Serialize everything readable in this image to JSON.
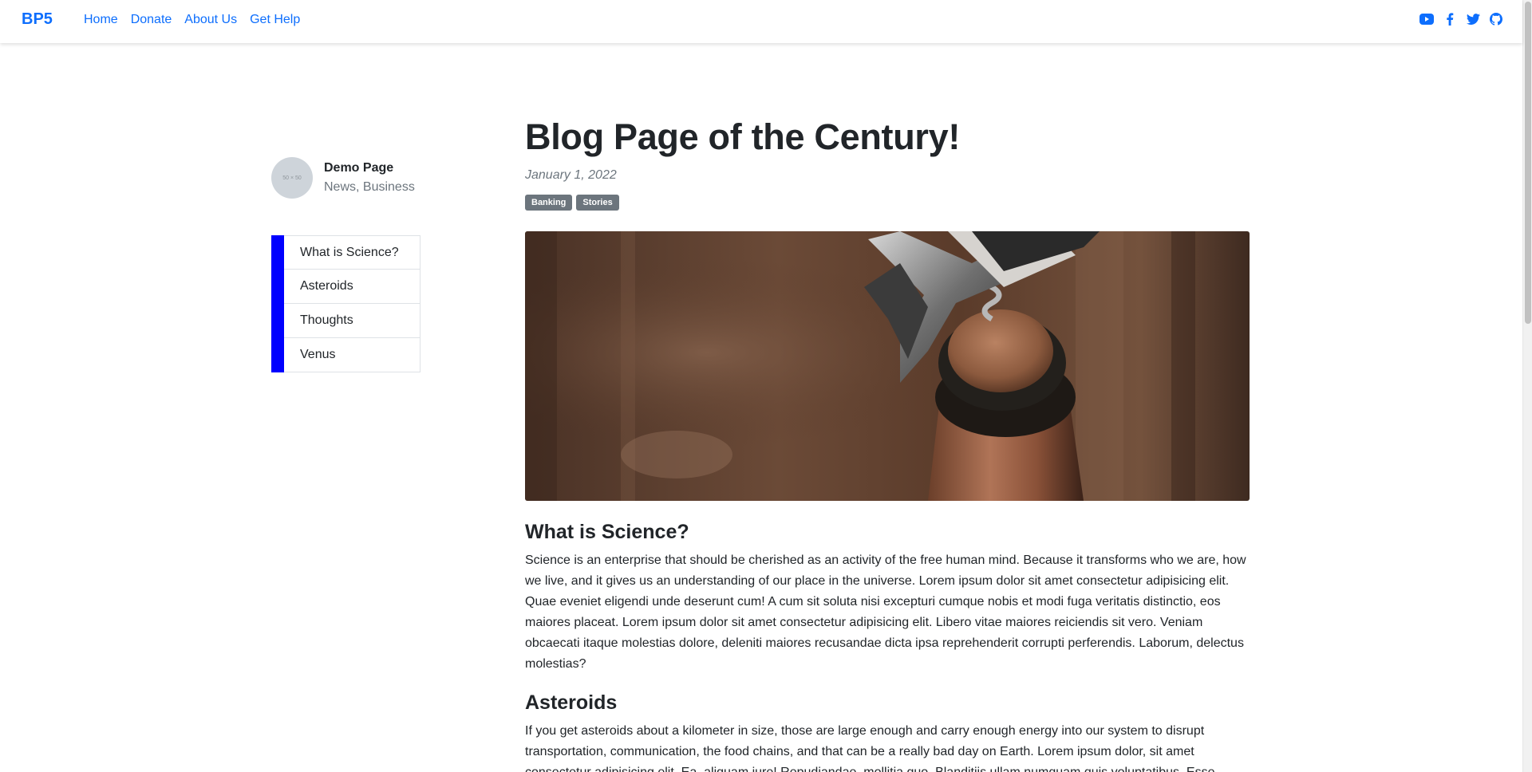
{
  "navbar": {
    "brand": "BP5",
    "links": [
      "Home",
      "Donate",
      "About Us",
      "Get Help"
    ],
    "social_icons": [
      "youtube-icon",
      "facebook-icon",
      "twitter-icon",
      "github-icon"
    ],
    "accent_color": "#0d6efd"
  },
  "sidebar": {
    "avatar_text": "50 × 50",
    "author_name": "Demo Page",
    "author_categories": "News, Business",
    "toc_accent": "#0000ff",
    "toc": [
      "What is Science?",
      "Asteroids",
      "Thoughts",
      "Venus"
    ]
  },
  "post": {
    "title": "Blog Page of the Century!",
    "date": "January 1, 2022",
    "tags": [
      "Banking",
      "Stories"
    ],
    "hero_image": "wine-bottle-corkscrew-photo",
    "sections": [
      {
        "heading": "What is Science?",
        "body": "Science is an enterprise that should be cherished as an activity of the free human mind. Because it transforms who we are, how we live, and it gives us an understanding of our place in the universe. Lorem ipsum dolor sit amet consectetur adipisicing elit. Quae eveniet eligendi unde deserunt cum! A cum sit soluta nisi excepturi cumque nobis et modi fuga veritatis distinctio, eos maiores placeat. Lorem ipsum dolor sit amet consectetur adipisicing elit. Libero vitae maiores reiciendis sit vero. Veniam obcaecati itaque molestias dolore, deleniti maiores recusandae dicta ipsa reprehenderit corrupti perferendis. Laborum, delectus molestias?"
      },
      {
        "heading": "Asteroids",
        "body": "If you get asteroids about a kilometer in size, those are large enough and carry enough energy into our system to disrupt transportation, communication, the food chains, and that can be a really bad day on Earth. Lorem ipsum dolor, sit amet consectetur adipisicing elit. Ea, aliquam iure! Repudiandae, mollitia quo. Blanditiis ullam numquam quis voluptatibus. Esse,"
      }
    ]
  }
}
